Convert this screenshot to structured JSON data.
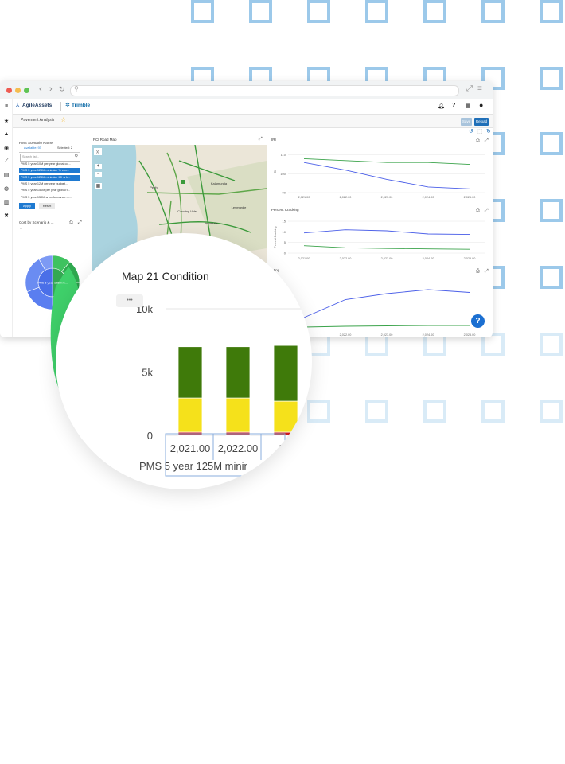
{
  "app": {
    "brand": "AgileAssets",
    "partner": "Trimble",
    "page_title": "Pavement Analysis",
    "save_label": "Save",
    "reload_label": "Reload"
  },
  "scenario_panel": {
    "title": "PMS Scenario Name",
    "tab_available": "Available: 93",
    "tab_selected": "Selected: 2",
    "search_placeholder": "Search list...",
    "items": [
      {
        "label": "PMS 5 year 10M per year global co...",
        "selected": false
      },
      {
        "label": "PMS 5 year 125M minimize % con...",
        "selected": true
      },
      {
        "label": "PMS 5 year 125M minimize IRI w b...",
        "selected": true
      },
      {
        "label": "PMS 5 year 12M per year budget...",
        "selected": false
      },
      {
        "label": "PMS 5 year 150M per year global t...",
        "selected": false
      },
      {
        "label": "PMS 5 year 150M w performance re...",
        "selected": false
      }
    ],
    "apply_label": "Apply",
    "reset_label": "Reset"
  },
  "cost_panel": {
    "title": "Cost by Scenario & ...",
    "dots": "...",
    "center_label": "PMS 5 year 125M m..."
  },
  "map_panel": {
    "title": "PCI Road Map",
    "place_labels": [
      "Perth",
      "Kalamunda",
      "Armadale",
      "Canning Vale",
      "Rockingham",
      "Lesmurdie"
    ]
  },
  "map2_panel": {
    "title": "Map"
  },
  "iri_panel": {
    "title": "IRI",
    "yticks": [
      "110",
      "100",
      "90"
    ],
    "ylabel": "IRI",
    "xticks": [
      "2,021.00",
      "2,022.00",
      "2,023.00",
      "2,024.00",
      "2,025.00"
    ]
  },
  "cracking_panel": {
    "title": "Percent Cracking",
    "yticks": [
      "15",
      "10",
      "5",
      "0"
    ],
    "ylabel": "Percent Cracking",
    "xticks": [
      "2,021.00",
      "2,022.00",
      "2,023.00",
      "2,024.00",
      "2,025.00"
    ]
  },
  "rutting_panel": {
    "title": "ting",
    "xticks": [
      ".00",
      "2,022.00",
      "2,023.00",
      "2,024.00",
      "2,025.00"
    ]
  },
  "zoom": {
    "title": "Map 21 Condition",
    "menu": "•••",
    "yticks": [
      "10k",
      "5k",
      "0"
    ],
    "xticks": [
      "2,021.00",
      "2,022.00",
      "2,0"
    ],
    "xlabel": "PMS 5 year 125M minir"
  },
  "help_label": "?",
  "colors": {
    "accent_blue": "#1f7ad1",
    "deco_square": "#9cc9ea",
    "good_green": "#3f7a0a",
    "fair_yellow": "#f5e11b",
    "poor_red": "#cc1a1a",
    "series_blue": "#4a5ee8",
    "series_green": "#3aa34a"
  },
  "chart_data": [
    {
      "type": "line",
      "title": "IRI",
      "ylabel": "IRI",
      "x": [
        2021,
        2022,
        2023,
        2024,
        2025
      ],
      "series": [
        {
          "values": [
            106,
            102,
            97,
            93,
            92
          ]
        },
        {
          "values": [
            108,
            107,
            106,
            106,
            105
          ]
        }
      ],
      "ylim": [
        90,
        112
      ]
    },
    {
      "type": "line",
      "title": "Percent Cracking",
      "ylabel": "Percent Cracking",
      "x": [
        2021,
        2022,
        2023,
        2024,
        2025
      ],
      "series": [
        {
          "values": [
            9.5,
            11,
            10.5,
            9,
            8.8
          ]
        },
        {
          "values": [
            3.5,
            2.5,
            2.2,
            2,
            1.8
          ]
        }
      ],
      "ylim": [
        0,
        15
      ]
    },
    {
      "type": "line",
      "title": "ting",
      "x": [
        2021,
        2022,
        2023,
        2024,
        2025
      ],
      "series": [
        {
          "values": [
            0.3,
            0.75,
            0.9,
            1.0,
            0.93
          ]
        },
        {
          "values": [
            0.06,
            0.08,
            0.09,
            0.1,
            0.1
          ]
        }
      ],
      "ylim": [
        0,
        1.2
      ]
    },
    {
      "type": "bar",
      "title": "Map 21 Condition",
      "categories": [
        "2,021.00",
        "2,022.00",
        "2,0"
      ],
      "xlabel": "PMS 5 year 125M minir",
      "ylim": [
        0,
        10000
      ],
      "series": [
        {
          "color": "#cc1a1a",
          "values": [
            250,
            250,
            250
          ]
        },
        {
          "color": "#f5e11b",
          "values": [
            2700,
            2700,
            2450
          ]
        },
        {
          "color": "#3f7a0a",
          "values": [
            4050,
            4050,
            4400
          ]
        }
      ]
    }
  ]
}
